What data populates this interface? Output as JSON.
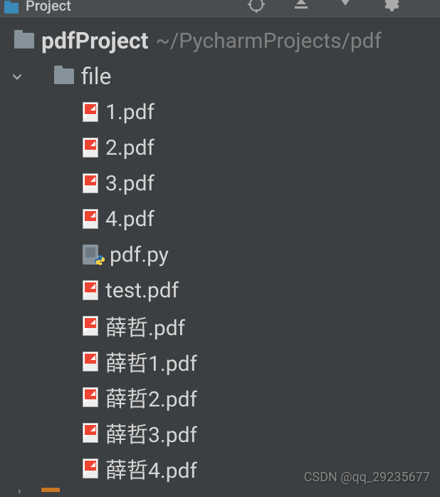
{
  "topbar": {
    "title": "Project"
  },
  "project": {
    "name": "pdfProject",
    "path": "~/PycharmProjects/pdf"
  },
  "folder": {
    "name": "file"
  },
  "files": [
    {
      "name": "1.pdf",
      "type": "pdf"
    },
    {
      "name": "2.pdf",
      "type": "pdf"
    },
    {
      "name": "3.pdf",
      "type": "pdf"
    },
    {
      "name": "4.pdf",
      "type": "pdf"
    },
    {
      "name": "pdf.py",
      "type": "python"
    },
    {
      "name": "test.pdf",
      "type": "pdf"
    },
    {
      "name": "薛哲.pdf",
      "type": "pdf"
    },
    {
      "name": "薛哲1.pdf",
      "type": "pdf"
    },
    {
      "name": "薛哲2.pdf",
      "type": "pdf"
    },
    {
      "name": "薛哲3.pdf",
      "type": "pdf"
    },
    {
      "name": "薛哲4.pdf",
      "type": "pdf"
    }
  ],
  "watermark": "CSDN @qq_29235677"
}
